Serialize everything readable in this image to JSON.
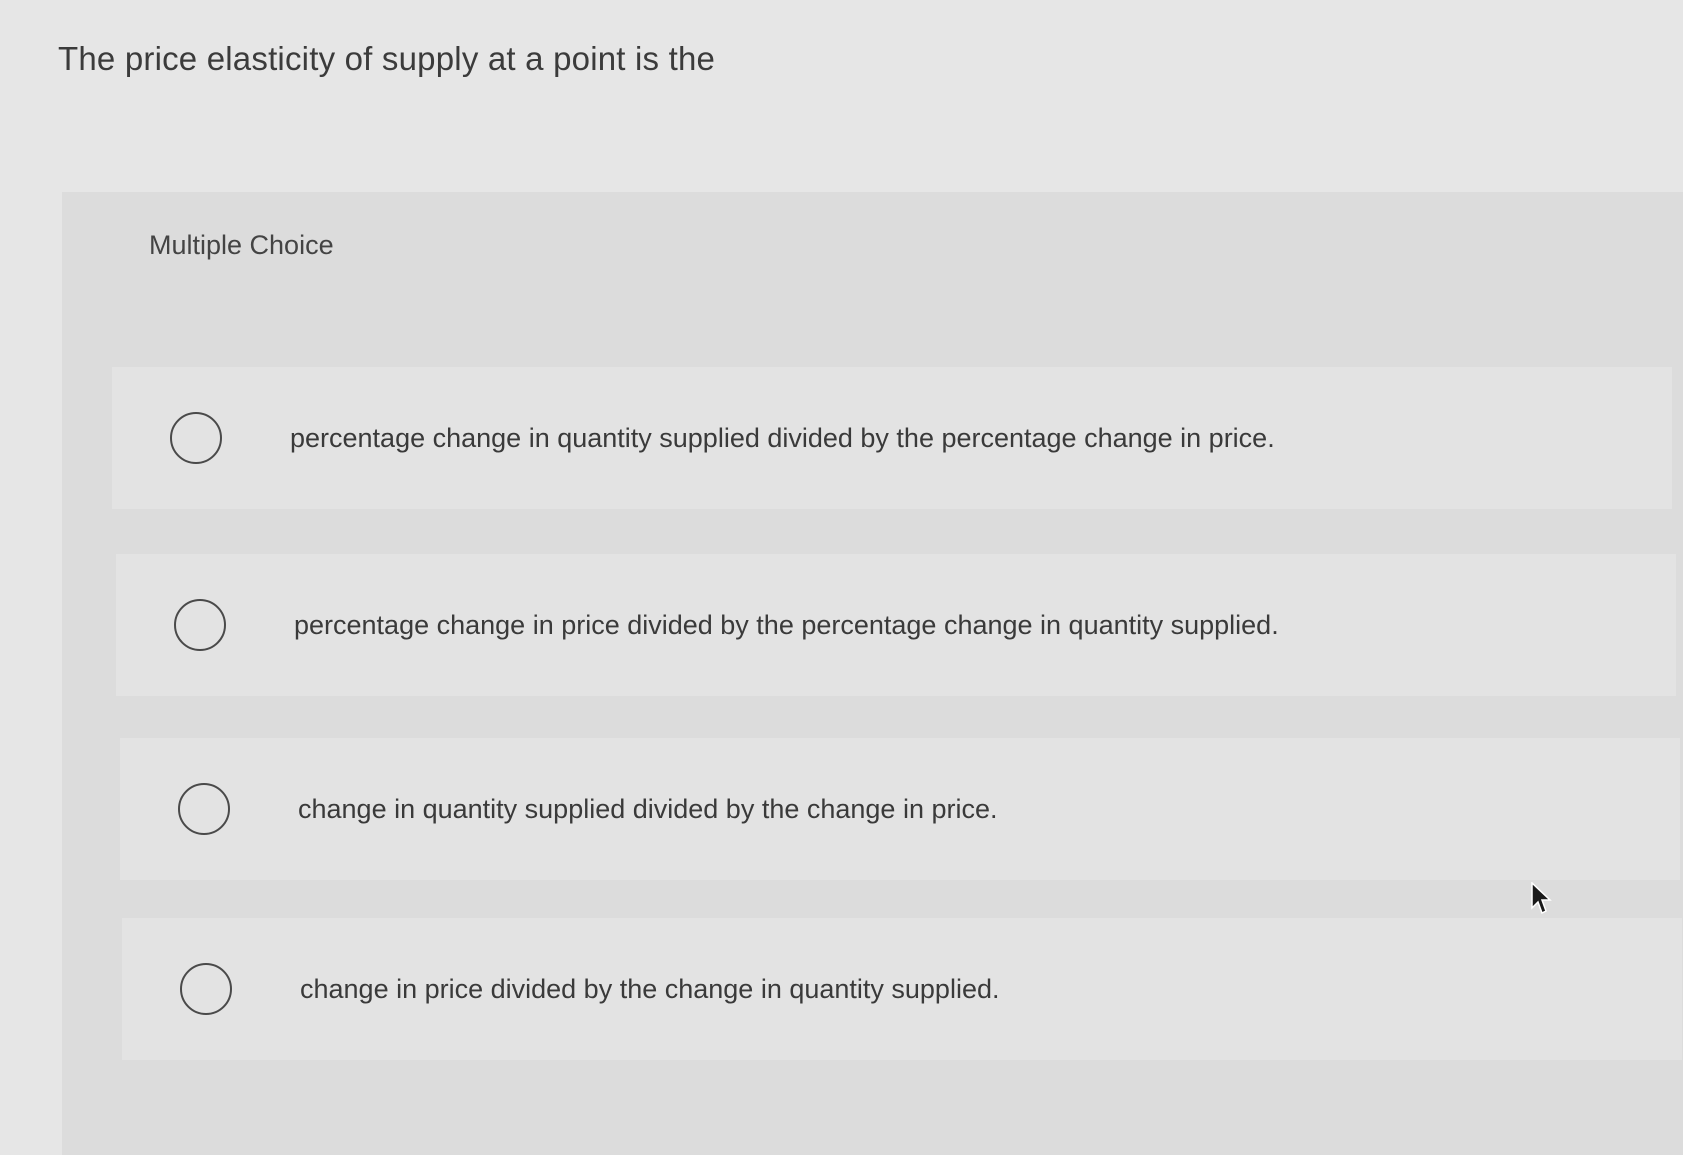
{
  "question": {
    "prompt": "The price elasticity of supply at a point is the"
  },
  "choices": {
    "header": "Multiple Choice",
    "options": [
      {
        "label": "percentage change in quantity supplied divided by the percentage change in price.",
        "selected": false
      },
      {
        "label": "percentage change in price divided by the percentage change in quantity supplied.",
        "selected": false
      },
      {
        "label": "change in quantity supplied divided by the change in price.",
        "selected": false
      },
      {
        "label": "change in price divided by the change in quantity supplied.",
        "selected": false
      }
    ]
  },
  "icons": {
    "radio": "radio-unchecked-icon",
    "cursor": "mouse-pointer-icon"
  },
  "colors": {
    "page_background": "#e6e6e6",
    "panel_background": "#dcdcdc",
    "option_background": "#e3e3e3",
    "text": "#3a3a3a"
  }
}
